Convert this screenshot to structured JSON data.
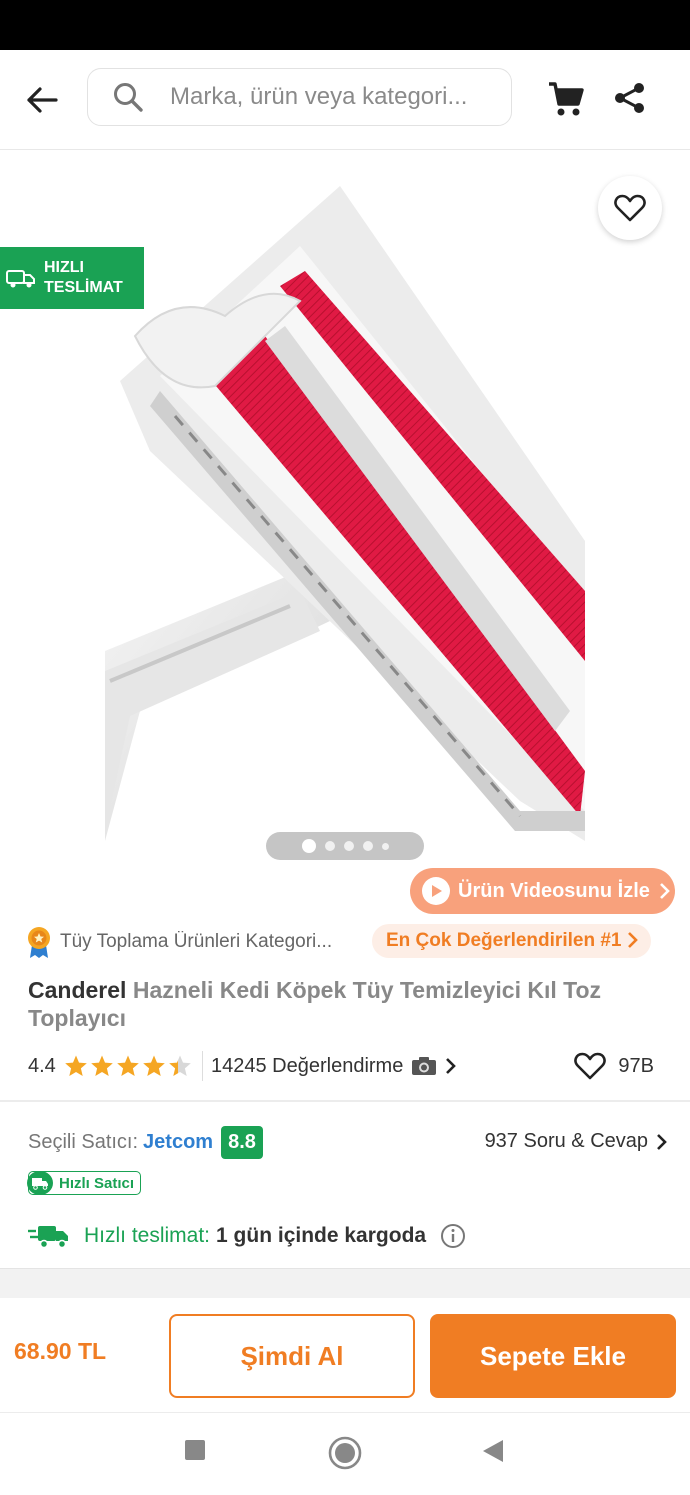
{
  "search": {
    "placeholder": "Marka, ürün veya kategori..."
  },
  "badge": {
    "fast_delivery_line1": "HIZLI",
    "fast_delivery_line2": "TESLİMAT"
  },
  "gallery": {
    "total_images": 5,
    "active_index": 0
  },
  "video_button": {
    "label": "Ürün Videosunu İzle"
  },
  "category": {
    "text": "Tüy Toplama Ürünleri Kategori...",
    "best_rated_label": "En Çok Değerlendirilen #1"
  },
  "product": {
    "brand": "Canderel",
    "name": "Hazneli Kedi Köpek Tüy Temizleyici Kıl Toz Toplayıcı",
    "rating": "4.4",
    "rating_stars": 4.4,
    "reviews": "14245 Değerlendirme",
    "likes": "97B"
  },
  "seller": {
    "label": "Seçili Satıcı:",
    "name": "Jetcom",
    "score": "8.8",
    "qa": "937 Soru & Cevap",
    "fast_seller": "Hızlı Satıcı"
  },
  "delivery": {
    "label": "Hızlı teslimat:",
    "value": "1 gün içinde kargoda"
  },
  "purchase": {
    "price": "68.90 TL",
    "buy_now": "Şimdi Al",
    "add_to_cart": "Sepete Ekle"
  },
  "colors": {
    "brand_orange": "#f07d23",
    "green": "#1aa254",
    "link_blue": "#2f7fd0",
    "pill_bg": "#fdeee6",
    "video_bg": "#f8a17c"
  },
  "icons": [
    "back-arrow-icon",
    "search-icon",
    "cart-icon",
    "share-icon",
    "heart-icon",
    "truck-icon",
    "play-icon",
    "chevron-right-icon",
    "medal-icon",
    "star-icon",
    "camera-icon",
    "info-icon"
  ]
}
